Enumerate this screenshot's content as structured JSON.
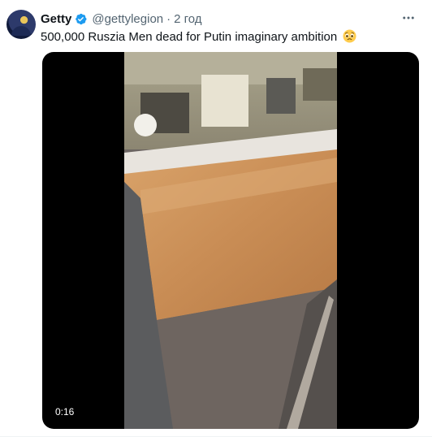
{
  "tweet": {
    "author_name": "Getty",
    "handle": "@gettylegion",
    "separator": "·",
    "time": "2 год",
    "text": "500,000 Ruszia Men dead for Putin imaginary ambition",
    "text_emoji": "pleading-face-emoji",
    "verified_icon": "verified-badge-icon",
    "more_icon": "more-horizontal-icon"
  },
  "media": {
    "type": "video",
    "duration": "0:16"
  },
  "colors": {
    "text": "#0f1419",
    "secondary_text": "#536471",
    "verified": "#1d9bf0",
    "video_bg": "#000000"
  }
}
